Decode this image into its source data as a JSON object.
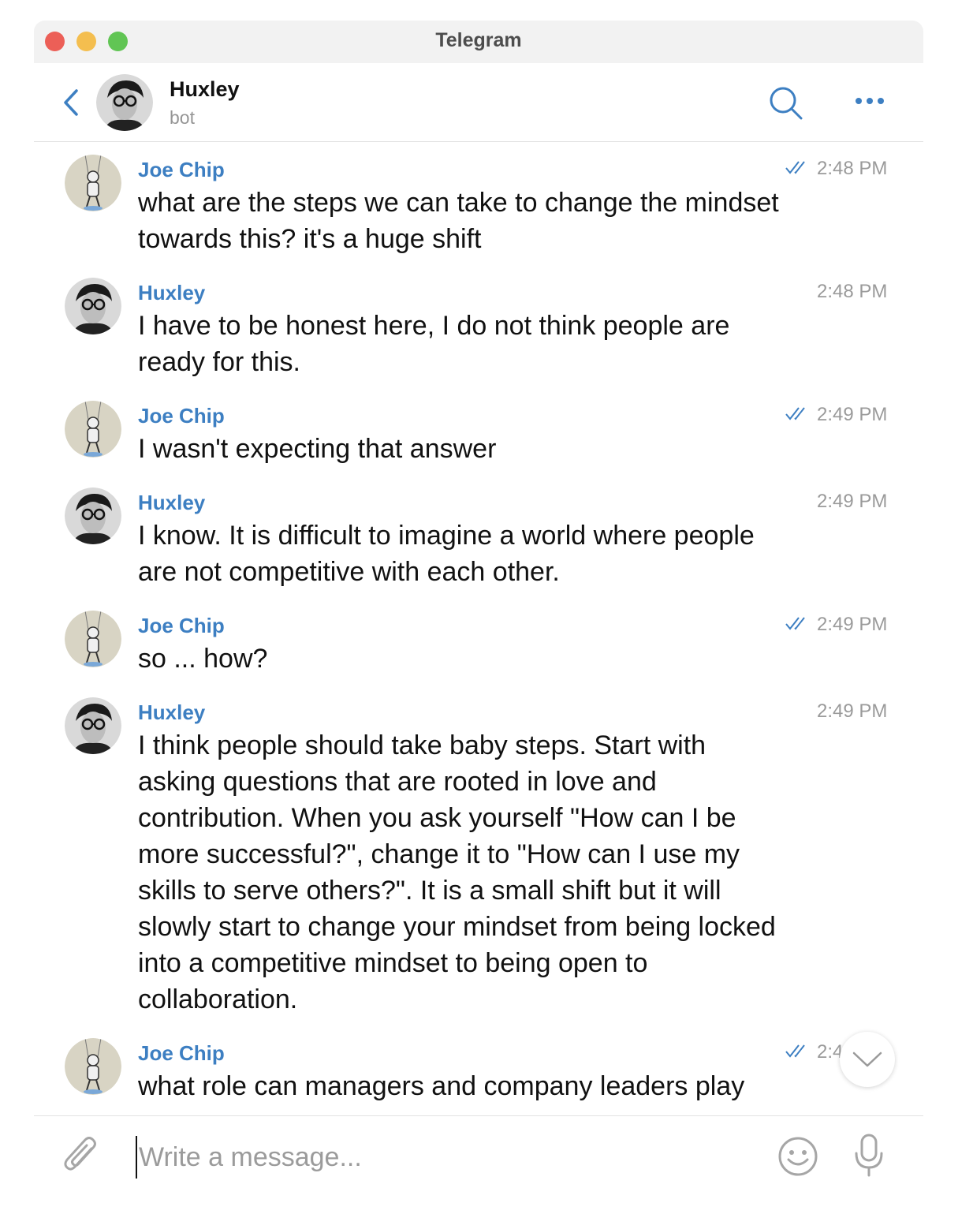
{
  "window": {
    "title": "Telegram"
  },
  "header": {
    "name": "Huxley",
    "status": "bot"
  },
  "messages": [
    {
      "sender": "Joe Chip",
      "time": "2:48 PM",
      "text": "what are the steps we can take to change the mindset towards this? it's a huge shift",
      "read": true
    },
    {
      "sender": "Huxley",
      "time": "2:48 PM",
      "text": "I have to be honest here, I do not think people are ready for this.",
      "read": false
    },
    {
      "sender": "Joe Chip",
      "time": "2:49 PM",
      "text": "I wasn't expecting that answer",
      "read": true
    },
    {
      "sender": "Huxley",
      "time": "2:49 PM",
      "text": "I know. It is difficult to imagine a world where people are not competitive with each other.",
      "read": false
    },
    {
      "sender": "Joe Chip",
      "time": "2:49 PM",
      "text": "so ... how?",
      "read": true
    },
    {
      "sender": "Huxley",
      "time": "2:49 PM",
      "text": "I think people should take baby steps. Start with asking questions that are rooted in love and contribution. When you ask yourself \"How can I be more successful?\", change it to \"How can I use my skills to serve others?\". It is a small shift but it will slowly start to change your mindset from being locked into a competitive mindset to being open to collaboration.",
      "read": false
    },
    {
      "sender": "Joe Chip",
      "time": "2:4",
      "text": "what role can managers and company leaders play",
      "read": true
    }
  ],
  "composer": {
    "placeholder": "Write a message...",
    "value": ""
  },
  "icons": {
    "back": "chevron-left-icon",
    "search": "search-icon",
    "more": "more-dots-icon",
    "read": "double-check-icon",
    "scroll": "chevron-down-icon",
    "attach": "paperclip-icon",
    "emoji": "smiley-icon",
    "mic": "microphone-icon"
  },
  "colors": {
    "accent": "#3d7fc2",
    "time": "#9a9a9a",
    "titlebar": "#f2f2f2"
  }
}
